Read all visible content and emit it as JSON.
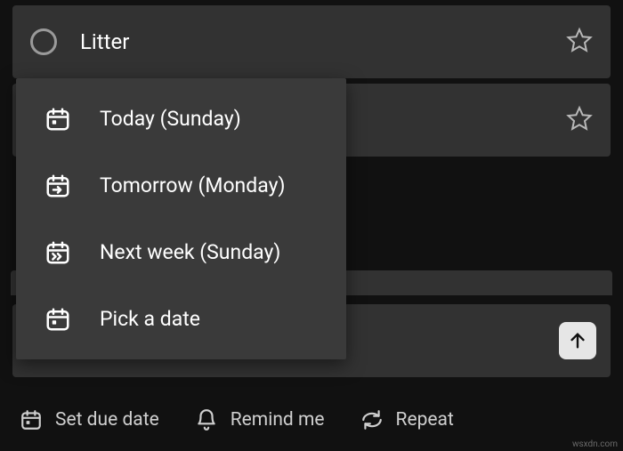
{
  "task1": {
    "title": "Litter"
  },
  "task2": {
    "title": ""
  },
  "popup": {
    "items": [
      {
        "label": "Today (Sunday)"
      },
      {
        "label": "Tomorrow (Monday)"
      },
      {
        "label": "Next week (Sunday)"
      },
      {
        "label": "Pick a date"
      }
    ]
  },
  "toolbar": {
    "due": "Set due date",
    "remind": "Remind me",
    "repeat": "Repeat"
  },
  "watermark": "wsxdn.com"
}
